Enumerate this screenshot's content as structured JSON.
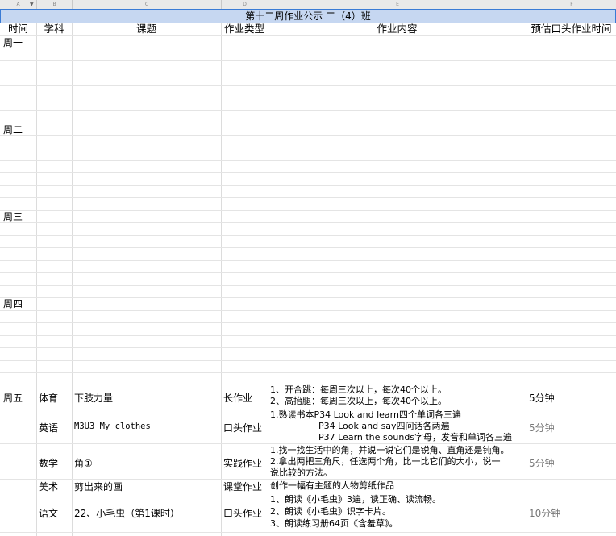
{
  "sheet": {
    "column_letters": [
      "A",
      "B",
      "C",
      "D",
      "E",
      "F"
    ],
    "title": "第十二周作业公示 二（4）班",
    "headers": [
      "时间",
      "学科",
      "课题",
      "作业类型",
      "作业内容",
      "预估口头作业时间"
    ],
    "days": [
      "周一",
      "周二",
      "周三",
      "周四",
      "周五"
    ],
    "friday_rows": [
      {
        "subject": "体育",
        "topic": "下肢力量",
        "type": "长作业",
        "content": [
          "1、开合跳：每周三次以上，每次40个以上。",
          "2、高抬腿：每周三次以上，每次40个以上。"
        ],
        "time": "5分钟"
      },
      {
        "subject": "英语",
        "topic": "M3U3 My clothes",
        "type": "口头作业",
        "content": [
          "1.熟读书本P34 Look and learn四个单词各三遍",
          "P34 Look and say四问话各两遍",
          "P37 Learn the sounds字母，发音和单词各三遍"
        ],
        "time": "5分钟"
      },
      {
        "subject": "数学",
        "topic": "角①",
        "type": "实践作业",
        "content": [
          "1.找一找生活中的角，并说一说它们是锐角、直角还是钝角。",
          "2.拿出两把三角尺，任选两个角，比一比它们的大小，说一",
          "说比较的方法。"
        ],
        "time": "5分钟"
      },
      {
        "subject": "美术",
        "topic": "剪出来的画",
        "type": "课堂作业",
        "content": [
          "创作一幅有主题的人物剪纸作品"
        ],
        "time": ""
      },
      {
        "subject": "语文",
        "topic": "22、小毛虫（第1课时）",
        "type": "口头作业",
        "content": [
          "1、朗读《小毛虫》3遍，读正确、读流畅。",
          "2、朗读《小毛虫》识字卡片。",
          "3、朗读练习册64页《含羞草》。"
        ],
        "time": "10分钟"
      }
    ]
  }
}
